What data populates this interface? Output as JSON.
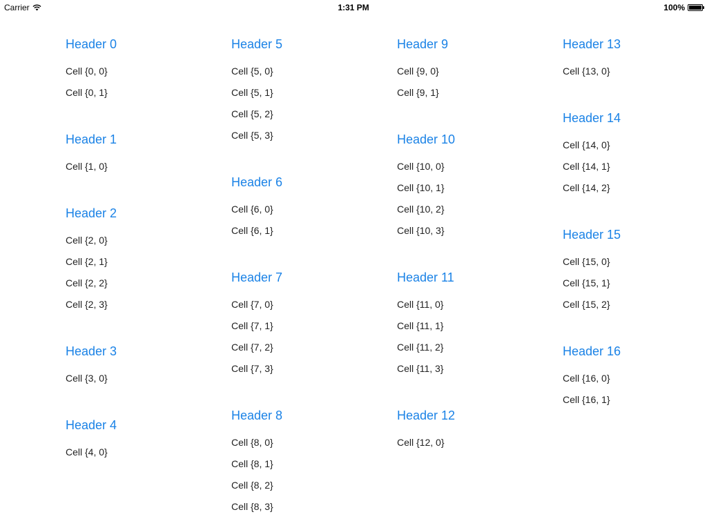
{
  "status_bar": {
    "carrier": "Carrier",
    "time": "1:31 PM",
    "battery": "100%",
    "battery_level": 1.0
  },
  "columns": [
    {
      "sections": [
        {
          "header": "Header 0",
          "cells": [
            "Cell {0, 0}",
            "Cell {0, 1}"
          ]
        },
        {
          "header": "Header 1",
          "cells": [
            "Cell {1, 0}"
          ]
        },
        {
          "header": "Header 2",
          "cells": [
            "Cell {2, 0}",
            "Cell {2, 1}",
            "Cell {2, 2}",
            "Cell {2, 3}"
          ]
        },
        {
          "header": "Header 3",
          "cells": [
            "Cell {3, 0}"
          ]
        },
        {
          "header": "Header 4",
          "cells": [
            "Cell {4, 0}"
          ]
        }
      ]
    },
    {
      "sections": [
        {
          "header": "Header 5",
          "cells": [
            "Cell {5, 0}",
            "Cell {5, 1}",
            "Cell {5, 2}",
            "Cell {5, 3}"
          ]
        },
        {
          "header": "Header 6",
          "cells": [
            "Cell {6, 0}",
            "Cell {6, 1}"
          ]
        },
        {
          "header": "Header 7",
          "cells": [
            "Cell {7, 0}",
            "Cell {7, 1}",
            "Cell {7, 2}",
            "Cell {7, 3}"
          ]
        },
        {
          "header": "Header 8",
          "cells": [
            "Cell {8, 0}",
            "Cell {8, 1}",
            "Cell {8, 2}",
            "Cell {8, 3}"
          ]
        }
      ]
    },
    {
      "sections": [
        {
          "header": "Header 9",
          "cells": [
            "Cell {9, 0}",
            "Cell {9, 1}"
          ]
        },
        {
          "header": "Header 10",
          "cells": [
            "Cell {10, 0}",
            "Cell {10, 1}",
            "Cell {10, 2}",
            "Cell {10, 3}"
          ]
        },
        {
          "header": "Header 11",
          "cells": [
            "Cell {11, 0}",
            "Cell {11, 1}",
            "Cell {11, 2}",
            "Cell {11, 3}"
          ]
        },
        {
          "header": "Header 12",
          "cells": [
            "Cell {12, 0}"
          ]
        }
      ]
    },
    {
      "sections": [
        {
          "header": "Header 13",
          "cells": [
            "Cell {13, 0}"
          ]
        },
        {
          "header": "Header 14",
          "cells": [
            "Cell {14, 0}",
            "Cell {14, 1}",
            "Cell {14, 2}"
          ]
        },
        {
          "header": "Header 15",
          "cells": [
            "Cell {15, 0}",
            "Cell {15, 1}",
            "Cell {15, 2}"
          ]
        },
        {
          "header": "Header 16",
          "cells": [
            "Cell {16, 0}",
            "Cell {16, 1}"
          ]
        }
      ]
    }
  ]
}
